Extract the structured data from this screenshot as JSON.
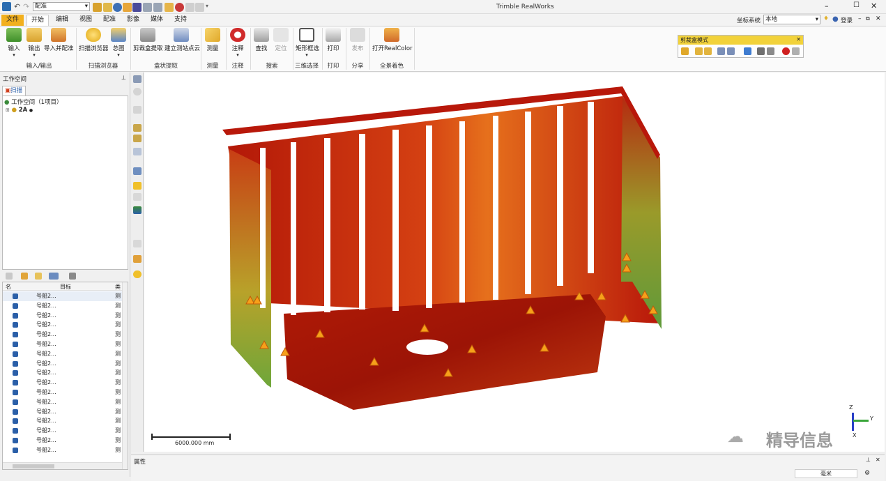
{
  "app": {
    "title": "Trimble RealWorks"
  },
  "quick_access": {
    "dropdown_value": "配准"
  },
  "menu": {
    "tabs": [
      "文件",
      "开始",
      "编辑",
      "视图",
      "配准",
      "影像",
      "媒体",
      "支持"
    ],
    "active": "开始"
  },
  "login": {
    "coord_label": "坐标系统",
    "coord_value": "本地",
    "login_label": "登录"
  },
  "ribbon": {
    "buttons": [
      "输入",
      "输出",
      "导入并配准",
      "扫描浏览器",
      "总图",
      "剪裁盒提取",
      "建立测站点云",
      "测量",
      "注释",
      "查找",
      "定位",
      "矩形框选",
      "打印",
      "发布",
      "打开RealColor"
    ],
    "groups": [
      "输入/输出",
      "扫描浏览器",
      "盒状提取",
      "测量",
      "注释",
      "搜索",
      "三维选择",
      "打印",
      "分享",
      "全景着色"
    ]
  },
  "clipbox": {
    "title": "剪裁盒模式"
  },
  "workspace": {
    "panel_title": "工作空间",
    "tab": "扫描",
    "root": "工作空间（1项目）",
    "child": "2A"
  },
  "list": {
    "headers": [
      "名",
      "目标",
      "类"
    ],
    "rows": [
      {
        "name": "号船2...",
        "type": "测"
      },
      {
        "name": "号船2...",
        "type": "测"
      },
      {
        "name": "号船2...",
        "type": "测"
      },
      {
        "name": "号船2...",
        "type": "测"
      },
      {
        "name": "号船2...",
        "type": "测"
      },
      {
        "name": "号船2...",
        "type": "测"
      },
      {
        "name": "号船2...",
        "type": "测"
      },
      {
        "name": "号船2...",
        "type": "测"
      },
      {
        "name": "号船2...",
        "type": "测"
      },
      {
        "name": "号船2...",
        "type": "测"
      },
      {
        "name": "号船2...",
        "type": "测"
      },
      {
        "name": "号船2...",
        "type": "测"
      },
      {
        "name": "号船2...",
        "type": "测"
      },
      {
        "name": "号船2...",
        "type": "测"
      },
      {
        "name": "号船2...",
        "type": "测"
      },
      {
        "name": "号船2...",
        "type": "测"
      },
      {
        "name": "号船2...",
        "type": "测"
      }
    ]
  },
  "viewport": {
    "scale_label": "6000.000 mm",
    "watermark": "精导信息",
    "axis_x": "X",
    "axis_y": "Y",
    "axis_z": "Z"
  },
  "properties": {
    "title": "属性",
    "unit": "毫米"
  },
  "colors": {
    "accent": "#f2b01e",
    "cloud_red": "#c81e0a",
    "cloud_green": "#9cc23a"
  }
}
